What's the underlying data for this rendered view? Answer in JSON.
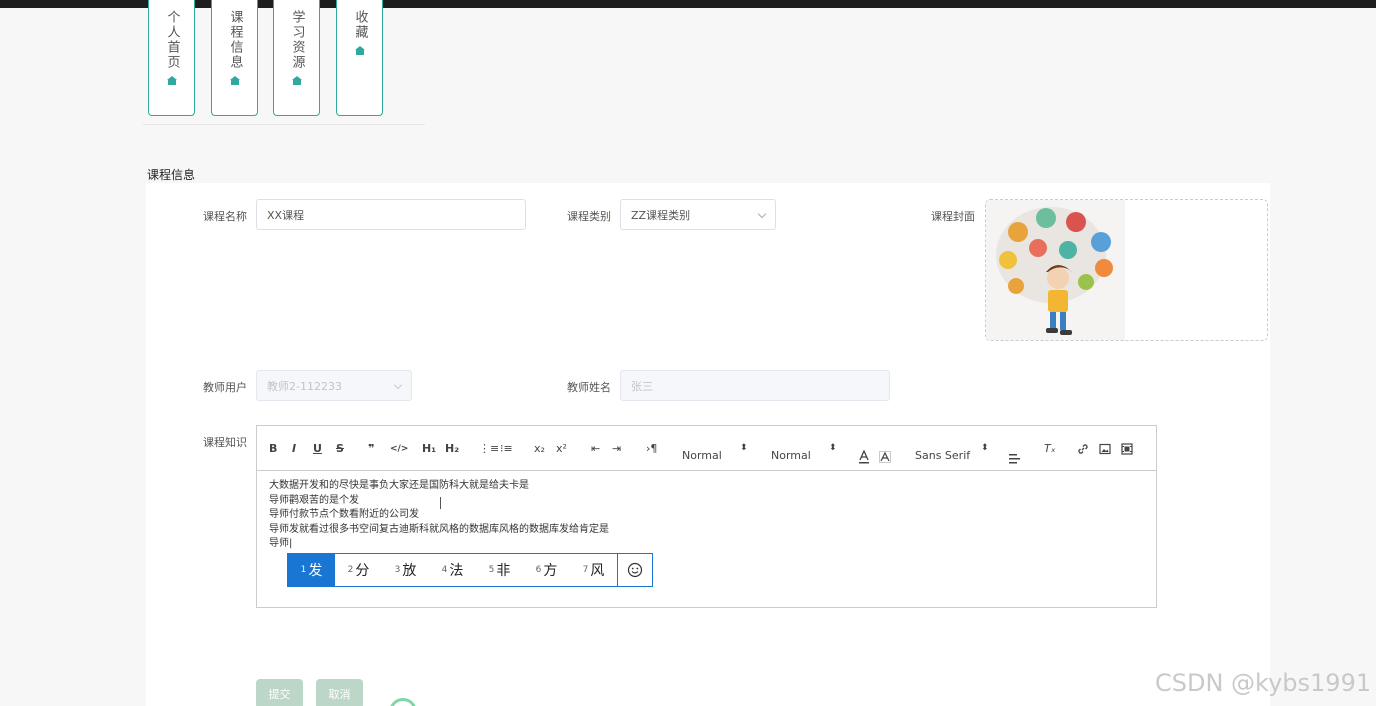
{
  "nav": [
    {
      "label": "个人首页",
      "icon": "home-icon"
    },
    {
      "label": "课程信息",
      "icon": "home-icon"
    },
    {
      "label": "学习资源",
      "icon": "home-icon"
    },
    {
      "label": "收藏",
      "icon": "home-icon"
    }
  ],
  "section_title": "课程信息",
  "form": {
    "course_name_label": "课程名称",
    "course_name_value": "XX课程",
    "course_type_label": "课程类别",
    "course_type_value": "ZZ课程类别",
    "cover_label": "课程封面",
    "teacher_user_label": "教师用户",
    "teacher_user_value": "教师2-112233",
    "teacher_name_label": "教师姓名",
    "teacher_name_value": "张三",
    "knowledge_label": "课程知识"
  },
  "editor": {
    "toolbar": {
      "bold": "B",
      "italic": "I",
      "underline": "U",
      "strike": "S",
      "quote": "❞",
      "code": "</>",
      "h1": "H₁",
      "h2": "H₂",
      "ordered": "⋮≡",
      "bullet": "⁝≡",
      "sub": "x₂",
      "sup": "x²",
      "outdent": "⇤",
      "indent": "⇥",
      "direction": "›¶",
      "size_select": "Normal",
      "header_select": "Normal",
      "font_select": "Sans Serif",
      "clean": "Tₓ"
    },
    "lines": [
      "大数据开发和的尽快是事负大家还是国防科大就是给夫卡是",
      "导师鹳艰苦的是个发",
      "导师付款节点个数看附近的公司发",
      "导师发就看过很多书空间复古迪斯科就风格的数据库风格的数据库发给肯定是",
      "导师|"
    ]
  },
  "ime": {
    "candidates": [
      {
        "num": "1",
        "char": "发"
      },
      {
        "num": "2",
        "char": "分"
      },
      {
        "num": "3",
        "char": "放"
      },
      {
        "num": "4",
        "char": "法"
      },
      {
        "num": "5",
        "char": "非"
      },
      {
        "num": "6",
        "char": "方"
      },
      {
        "num": "7",
        "char": "风"
      }
    ]
  },
  "buttons": {
    "submit": "提交",
    "cancel": "取消"
  },
  "watermark": "CSDN @kybs1991",
  "colors": {
    "accent": "#2fa89f",
    "ime_highlight": "#1976d2",
    "button_disabled": "#bcd6c8"
  }
}
